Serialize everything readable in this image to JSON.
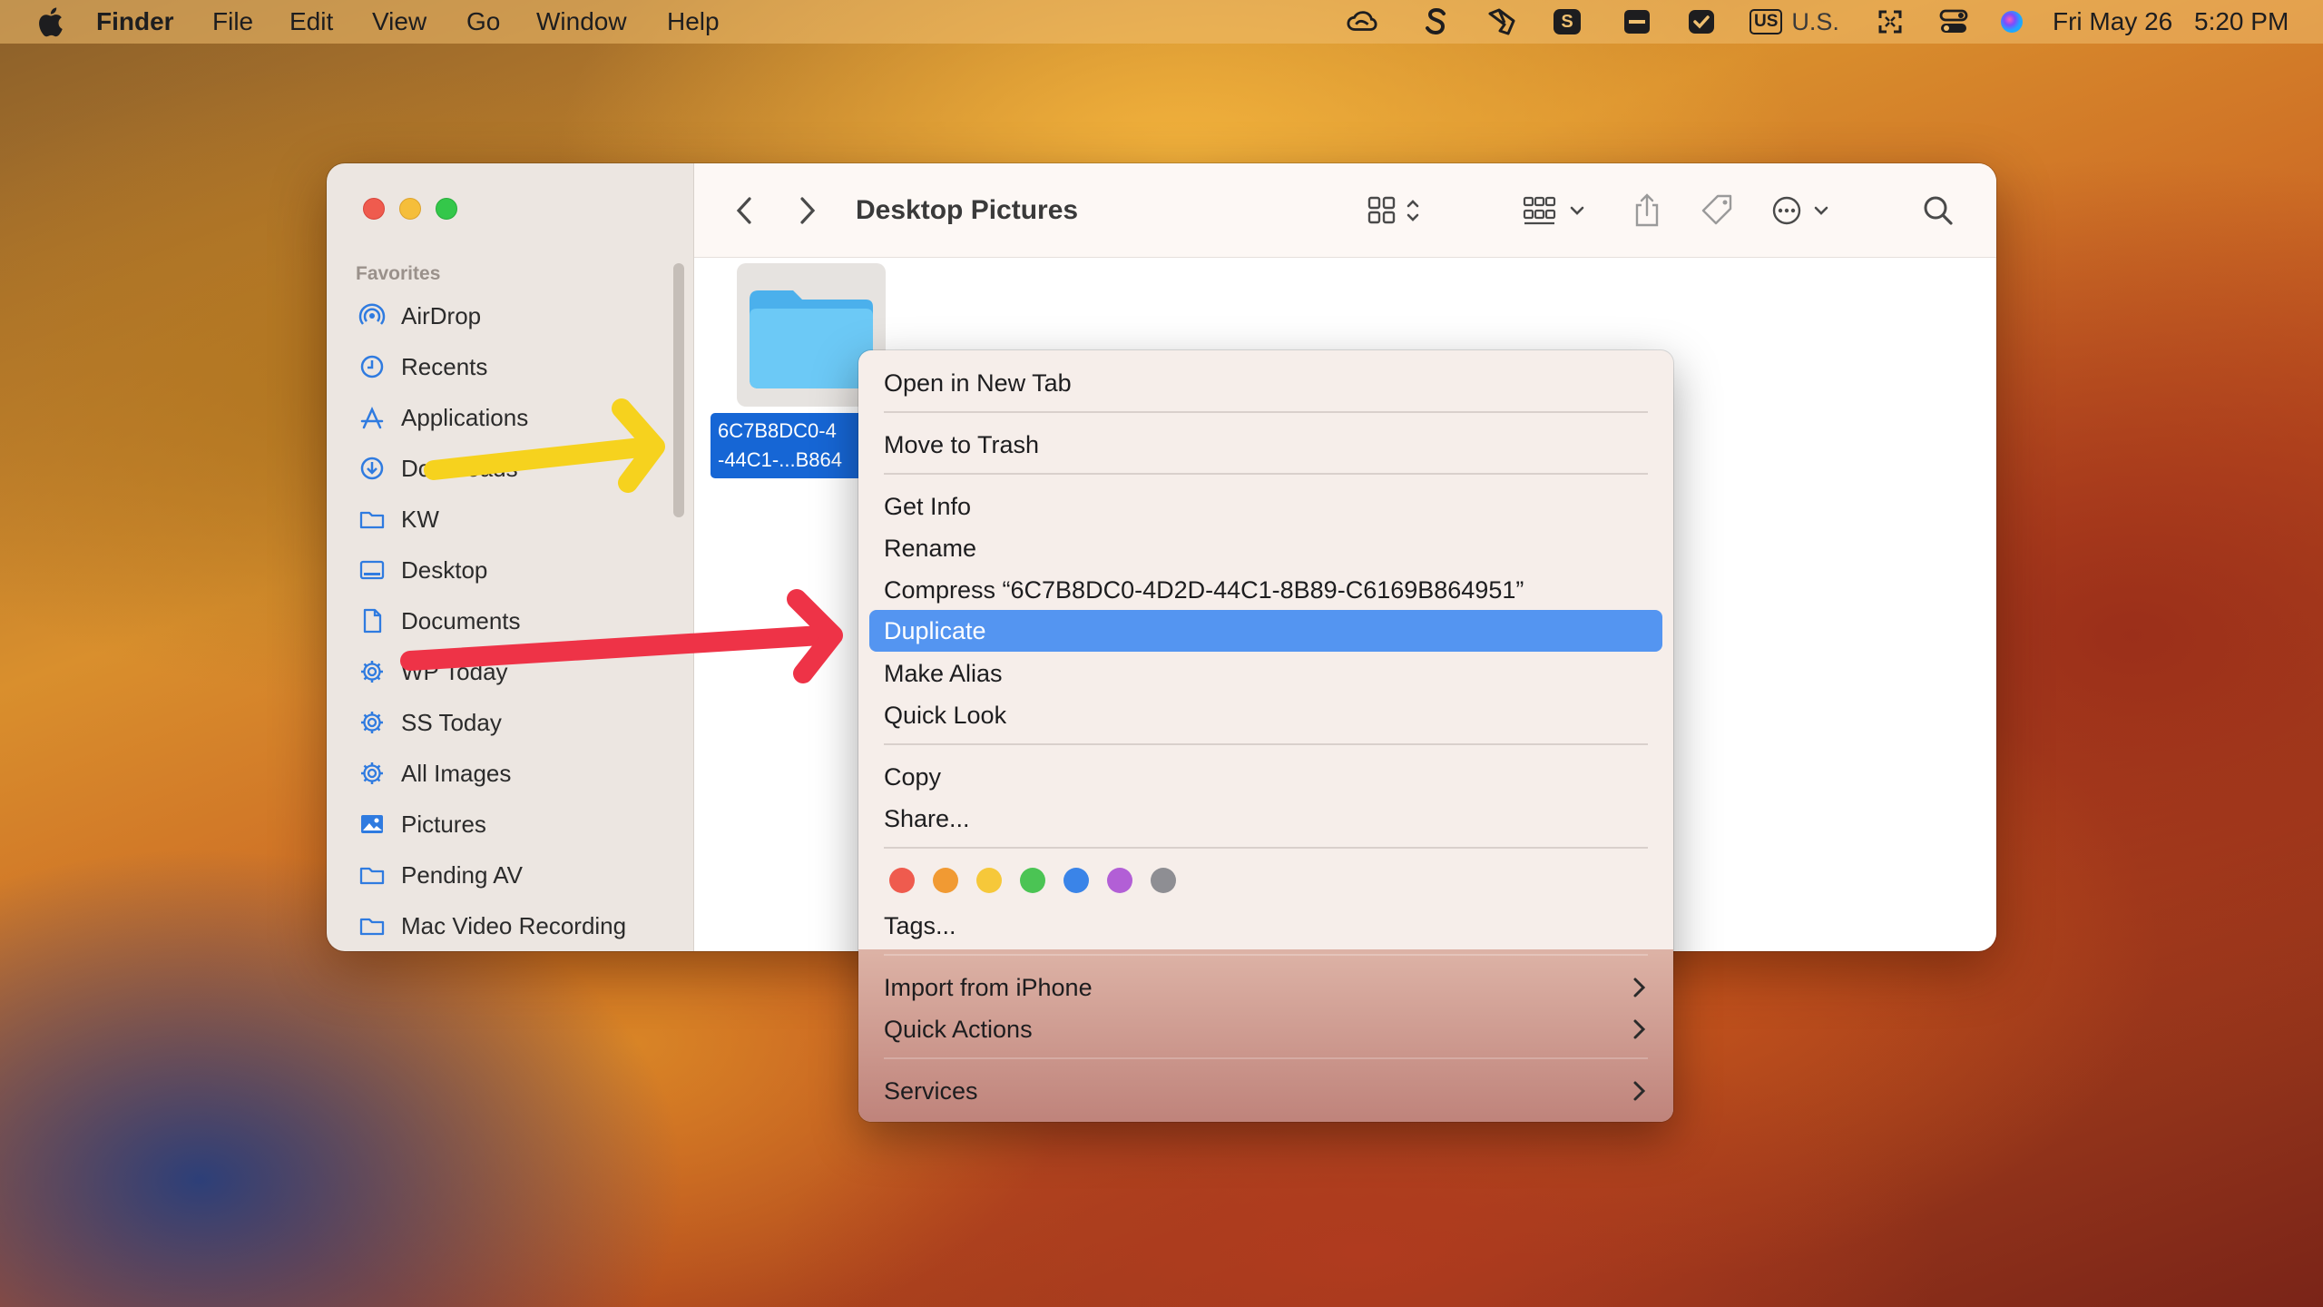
{
  "menubar": {
    "app_name": "Finder",
    "menus": [
      "File",
      "Edit",
      "View",
      "Go",
      "Window",
      "Help"
    ],
    "input_source": "U.S.",
    "input_badge": "US",
    "date": "Fri May 26",
    "time": "5:20 PM",
    "status_icons": [
      "creative-cloud-icon",
      "scrivener-icon",
      "shortcut-icon",
      "skype-icon",
      "display-icon",
      "checkmark-icon",
      "keyboard-icon",
      "expand-icon",
      "control-center-icon",
      "siri-icon"
    ]
  },
  "window": {
    "title": "Desktop Pictures",
    "sidebar": {
      "section_title": "Favorites",
      "items": [
        {
          "label": "AirDrop",
          "icon": "airdrop-icon"
        },
        {
          "label": "Recents",
          "icon": "clock-icon"
        },
        {
          "label": "Applications",
          "icon": "applications-icon"
        },
        {
          "label": "Downloads",
          "icon": "download-icon"
        },
        {
          "label": "KW",
          "icon": "folder-icon"
        },
        {
          "label": "Desktop",
          "icon": "desktop-icon"
        },
        {
          "label": "Documents",
          "icon": "document-icon"
        },
        {
          "label": "WP Today",
          "icon": "gear-icon"
        },
        {
          "label": "SS Today",
          "icon": "gear-icon"
        },
        {
          "label": "All Images",
          "icon": "gear-icon"
        },
        {
          "label": "Pictures",
          "icon": "photo-icon"
        },
        {
          "label": "Pending AV",
          "icon": "folder-icon"
        },
        {
          "label": "Mac Video Recording",
          "icon": "folder-icon"
        }
      ]
    },
    "file": {
      "label_line1": "6C7B8DC0-4",
      "label_line2": "-44C1-...B864"
    }
  },
  "context_menu": {
    "open_new_tab": "Open in New Tab",
    "move_to_trash": "Move to Trash",
    "get_info": "Get Info",
    "rename": "Rename",
    "compress": "Compress “6C7B8DC0-4D2D-44C1-8B89-C6169B864951”",
    "duplicate": "Duplicate",
    "make_alias": "Make Alias",
    "quick_look": "Quick Look",
    "copy": "Copy",
    "share": "Share...",
    "tags": "Tags...",
    "import_from_iphone": "Import from iPhone",
    "quick_actions": "Quick Actions",
    "services": "Services",
    "tag_colors": [
      "#ef5b4e",
      "#f19a33",
      "#f6c83a",
      "#4bc454",
      "#3a84e8",
      "#b25fd6",
      "#8e8e93"
    ],
    "highlighted_item": "Duplicate"
  },
  "annotations": {
    "yellow_arrow_color": "#f6d21e",
    "red_arrow_color": "#ee3347"
  }
}
